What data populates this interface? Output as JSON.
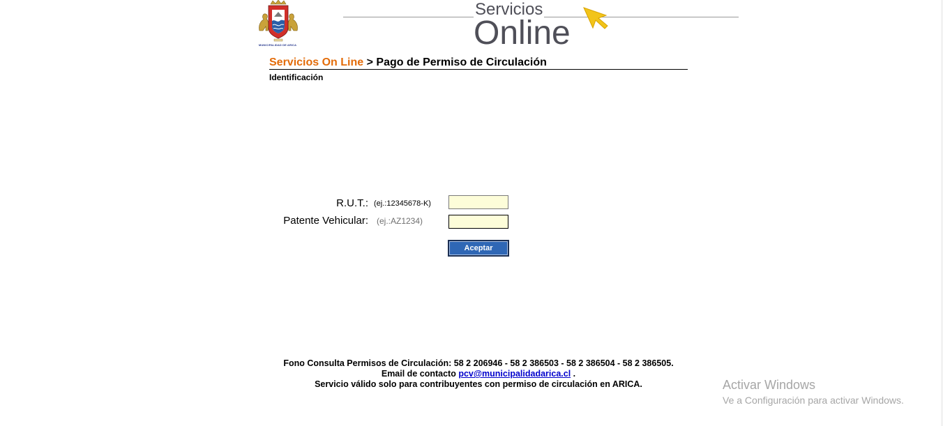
{
  "logo": {
    "caption": "MUNICIPALIDAD DE ARICA"
  },
  "header": {
    "title_top": "Servicios",
    "title_bottom": "Online"
  },
  "breadcrumb": {
    "link_label": "Servicios On Line",
    "separator": " > ",
    "current": "Pago de Permiso de Circulación"
  },
  "section": {
    "label": "Identificación"
  },
  "form": {
    "rut_label": "R.U.T.:",
    "rut_hint": "(ej.:12345678-K)",
    "rut_value": "",
    "patente_label": "Patente Vehicular:",
    "patente_hint": "(ej.:AZ1234)",
    "patente_value": "",
    "submit_label": "Aceptar"
  },
  "footer": {
    "phone_line": "Fono Consulta Permisos de Circulación: 58 2 206946 - 58 2 386503 - 58 2 386504 - 58 2 386505.",
    "email_prefix": "Email de contacto ",
    "email": "pcv@municipalidadarica.cl",
    "email_suffix": " .",
    "notice": "Servicio válido solo para contribuyentes con permiso de circulación en ARICA."
  },
  "watermark": {
    "title": "Activar Windows",
    "subtitle": "Ve a Configuración para activar Windows."
  },
  "colors": {
    "accent_orange": "#e36c0a",
    "button_blue": "#2f67b5",
    "input_bg": "#fdfdd9",
    "header_gray": "#4f4f58"
  }
}
